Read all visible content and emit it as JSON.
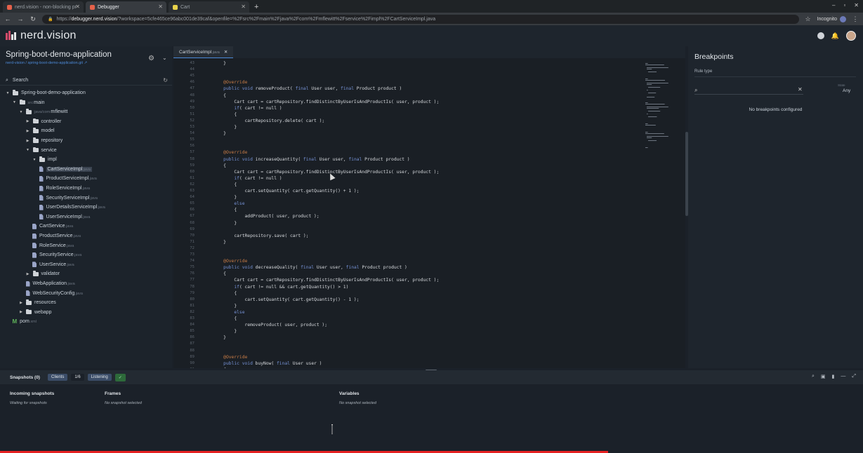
{
  "browser": {
    "tabs": [
      {
        "label": "nerd.vision - non-blocking pr",
        "active": false,
        "favicon_color": "#e6614a"
      },
      {
        "label": "Debugger",
        "active": true,
        "favicon_color": "#e6614a"
      },
      {
        "label": "Cart",
        "active": false,
        "favicon_color": "#e8d24a"
      }
    ],
    "new_tab": "+",
    "window_controls": [
      "–",
      "▫",
      "✕"
    ],
    "url_prefix": "https://",
    "url_host": "debugger.nerd.vision",
    "url_rest": "/?workspace=5cfe465ce96abc001de39caf&openfile=%2Fsrc%2Fmain%2Fjava%2Fcom%2Fmflewitt%2Fservice%2Fimpl%2FCartServiceImpl.java",
    "mode_label": "Incognito"
  },
  "app": {
    "logo_text": "nerd.vision",
    "logo_color": "#d24b6a"
  },
  "project": {
    "title": "Spring-boot-demo-application",
    "link": "nerd-vision / spring-boot-demo-application.git",
    "search_placeholder": "Search"
  },
  "tree": [
    {
      "label": "Spring-boot-demo-application",
      "depth": 0,
      "type": "folder",
      "open": true
    },
    {
      "label": "main",
      "prefix": "src/",
      "depth": 1,
      "type": "folder",
      "open": true
    },
    {
      "label": "mflewitt",
      "prefix": "java/com/",
      "depth": 2,
      "type": "folder",
      "open": true
    },
    {
      "label": "controller",
      "depth": 3,
      "type": "folder",
      "open": false
    },
    {
      "label": "model",
      "depth": 3,
      "type": "folder",
      "open": false
    },
    {
      "label": "repository",
      "depth": 3,
      "type": "folder",
      "open": false
    },
    {
      "label": "service",
      "depth": 3,
      "type": "folder",
      "open": true
    },
    {
      "label": "impl",
      "depth": 4,
      "type": "folder",
      "open": true
    },
    {
      "label": "CartServiceImpl",
      "ext": ".java",
      "depth": 5,
      "type": "file",
      "selected": true
    },
    {
      "label": "ProductServiceImpl",
      "ext": ".java",
      "depth": 5,
      "type": "file"
    },
    {
      "label": "RoleServiceImpl",
      "ext": ".java",
      "depth": 5,
      "type": "file"
    },
    {
      "label": "SecurityServiceImpl",
      "ext": ".java",
      "depth": 5,
      "type": "file"
    },
    {
      "label": "UserDetailsServiceImpl",
      "ext": ".java",
      "depth": 5,
      "type": "file"
    },
    {
      "label": "UserServiceImpl",
      "ext": ".java",
      "depth": 5,
      "type": "file"
    },
    {
      "label": "CartService",
      "ext": ".java",
      "depth": 4,
      "type": "file"
    },
    {
      "label": "ProductService",
      "ext": ".java",
      "depth": 4,
      "type": "file"
    },
    {
      "label": "RoleService",
      "ext": ".java",
      "depth": 4,
      "type": "file"
    },
    {
      "label": "SecurityService",
      "ext": ".java",
      "depth": 4,
      "type": "file"
    },
    {
      "label": "UserService",
      "ext": ".java",
      "depth": 4,
      "type": "file"
    },
    {
      "label": "validator",
      "depth": 3,
      "type": "folder",
      "open": false
    },
    {
      "label": "WebApplication",
      "ext": ".java",
      "depth": 3,
      "type": "file"
    },
    {
      "label": "WebSecurityConfig",
      "ext": ".java",
      "depth": 3,
      "type": "file"
    },
    {
      "label": "resources",
      "depth": 2,
      "type": "folder",
      "open": false
    },
    {
      "label": "webapp",
      "depth": 2,
      "type": "folder",
      "open": false
    },
    {
      "label": "pom",
      "ext": ".xml",
      "depth": 1,
      "type": "maven"
    }
  ],
  "editor": {
    "tab_name": "CartServiceImpl",
    "tab_ext": ".java",
    "tab_close": "✕",
    "lines": [
      {
        "n": "43",
        "t": "    }"
      },
      {
        "n": "44",
        "t": ""
      },
      {
        "n": "45",
        "t": ""
      },
      {
        "n": "46",
        "t": "    @Override"
      },
      {
        "n": "47",
        "t": "    public void removeProduct( final User user, final Product product )"
      },
      {
        "n": "48",
        "t": "    {"
      },
      {
        "n": "49",
        "t": "        Cart cart = cartRepository.findDistinctByUserIsAndProductIs( user, product );"
      },
      {
        "n": "50",
        "t": "        if( cart != null )"
      },
      {
        "n": "51",
        "t": "        {"
      },
      {
        "n": "52",
        "t": "            cartRepository.delete( cart );"
      },
      {
        "n": "53",
        "t": "        }"
      },
      {
        "n": "54",
        "t": "    }"
      },
      {
        "n": "55",
        "t": ""
      },
      {
        "n": "56",
        "t": ""
      },
      {
        "n": "57",
        "t": "    @Override"
      },
      {
        "n": "58",
        "t": "    public void increaseQuantity( final User user, final Product product )"
      },
      {
        "n": "59",
        "t": "    {"
      },
      {
        "n": "60",
        "t": "        Cart cart = cartRepository.findDistinctByUserIsAndProductIs( user, product );"
      },
      {
        "n": "61",
        "t": "        if( cart != null )"
      },
      {
        "n": "62",
        "t": "        {"
      },
      {
        "n": "63",
        "t": "            cart.setQuantity( cart.getQuantity() + 1 );"
      },
      {
        "n": "64",
        "t": "        }"
      },
      {
        "n": "65",
        "t": "        else"
      },
      {
        "n": "66",
        "t": "        {"
      },
      {
        "n": "67",
        "t": "            addProduct( user, product );"
      },
      {
        "n": "68",
        "t": "        }"
      },
      {
        "n": "69",
        "t": ""
      },
      {
        "n": "70",
        "t": "        cartRepository.save( cart );"
      },
      {
        "n": "71",
        "t": "    }"
      },
      {
        "n": "72",
        "t": ""
      },
      {
        "n": "73",
        "t": ""
      },
      {
        "n": "74",
        "t": "    @Override"
      },
      {
        "n": "75",
        "t": "    public void decreaseQuality( final User user, final Product product )"
      },
      {
        "n": "76",
        "t": "    {"
      },
      {
        "n": "77",
        "t": "        Cart cart = cartRepository.findDistinctByUserIsAndProductIs( user, product );"
      },
      {
        "n": "78",
        "t": "        if( cart != null && cart.getQuantity() > 1)"
      },
      {
        "n": "79",
        "t": "        {"
      },
      {
        "n": "80",
        "t": "            cart.setQuantity( cart.getQuantity() - 1 );"
      },
      {
        "n": "81",
        "t": "        }"
      },
      {
        "n": "82",
        "t": "        else"
      },
      {
        "n": "83",
        "t": "        {"
      },
      {
        "n": "84",
        "t": "            removeProduct( user, product );"
      },
      {
        "n": "85",
        "t": "        }"
      },
      {
        "n": "86",
        "t": "    }"
      },
      {
        "n": "87",
        "t": ""
      },
      {
        "n": "88",
        "t": ""
      },
      {
        "n": "89",
        "t": "    @Override"
      },
      {
        "n": "90",
        "t": "    public void buyNow( final User user )"
      },
      {
        "n": "91",
        "t": "    {"
      }
    ]
  },
  "breakpoints": {
    "title": "Breakpoints",
    "rule_type_label": "Rule type",
    "state_label": "State",
    "state_value": "Any",
    "clear_icon": "✕",
    "empty_text": "No breakpoints configured"
  },
  "snapshots": {
    "label": "Snapshots (0)",
    "clients_label": "Clients",
    "clients_count": "1/6",
    "listening_label": "Listening",
    "check": "✓",
    "incoming_title": "Incoming snapshots",
    "incoming_status": "Waiting for snapshots",
    "frames_title": "Frames",
    "frames_status": "No snapshot selected",
    "variables_title": "Variables",
    "variables_status": "No snapshot selected"
  },
  "colors": {
    "keyword": "#7591d4",
    "annotation": "#c77b45",
    "accent": "#4a8ad8",
    "progress": "#e52222"
  }
}
